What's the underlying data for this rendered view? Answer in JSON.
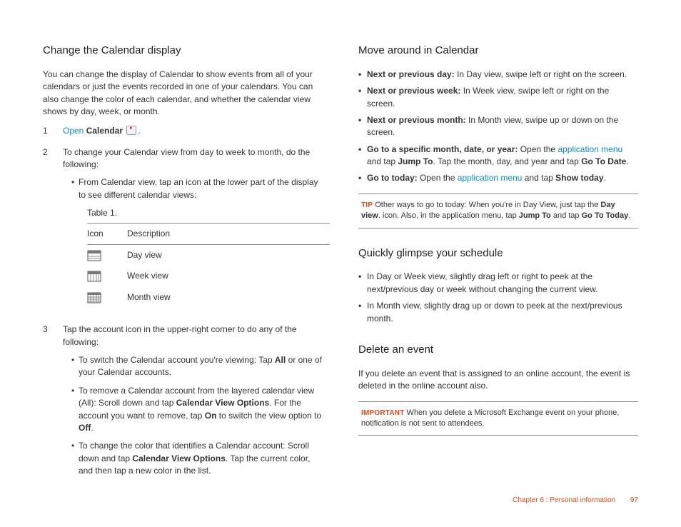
{
  "left": {
    "h1": "Change the Calendar display",
    "intro": "You can change the display of Calendar to show events from all of your calendars or just the events recorded in one of your calendars. You can also change the color of each calendar, and whether the calendar view shows by day, week, or month.",
    "step1_open": "Open",
    "step1_calendar": "Calendar",
    "step2": "To change your Calendar view from day to week to month, do the following:",
    "step2_bullet": "From Calendar view, tap an icon at the lower part of the display to see different calendar views:",
    "table_caption": "Table 1.",
    "th_icon": "Icon",
    "th_desc": "Description",
    "row_day": "Day view",
    "row_week": "Week view",
    "row_month": "Month view",
    "step3": "Tap the account icon in the upper-right corner to do any of the following:",
    "s3b1_a": "To switch the Calendar account you're viewing: Tap ",
    "s3b1_all": "All",
    "s3b1_b": " or one of your Calendar accounts.",
    "s3b2_a": "To remove a Calendar account from the layered calendar view (All): Scroll down and tap ",
    "s3b2_cvo": "Calendar View Options",
    "s3b2_b": ". For the account you want to remove, tap ",
    "s3b2_on": "On",
    "s3b2_c": " to switch the view option to ",
    "s3b2_off": "Off",
    "s3b2_d": ".",
    "s3b3_a": "To change the color that identifies a Calendar account: Scroll down and tap ",
    "s3b3_cvo": "Calendar View Options",
    "s3b3_b": ". Tap the current color, and then tap a new color in the list."
  },
  "right": {
    "h_move": "Move around in Calendar",
    "m1_b": "Next or previous day:",
    "m1_t": " In Day view, swipe left or right on the screen.",
    "m2_b": "Next or previous week:",
    "m2_t": " In Week view, swipe left or right on the screen.",
    "m3_b": "Next or previous month:",
    "m3_t": " In Month view, swipe up or down on the screen.",
    "m4_b": "Go to a specific month, date, or year:",
    "m4_t1": " Open the ",
    "m4_link": "application menu",
    "m4_t2": " and tap ",
    "m4_jump": "Jump To",
    "m4_t3": ". Tap the month, day, and year and tap ",
    "m4_gtd": "Go To Date",
    "m4_t4": ".",
    "m5_b": "Go to today:",
    "m5_t1": " Open the ",
    "m5_link": "application menu",
    "m5_t2": " and tap ",
    "m5_show": "Show today",
    "m5_t3": ".",
    "tip_label": "TIP",
    "tip_a": "  Other ways to go to today: When you're in Day View, just tap the ",
    "tip_dv": "Day view",
    "tip_b": ". icon. Also, in the application menu, tap ",
    "tip_jt": "Jump To",
    "tip_c": " and tap ",
    "tip_gtt": "Go To Today",
    "tip_d": ".",
    "h_glimpse": "Quickly glimpse your schedule",
    "g1": "In Day or Week view, slightly drag left or right to peek at the next/previous day or week without changing the current view.",
    "g2": "In Month view, slightly drag up or down to peek at the next/previous month.",
    "h_delete": "Delete an event",
    "del_p": "If you delete an event that is assigned to an online account, the event is deleted in the online account also.",
    "imp_label": "IMPORTANT",
    "imp_t": "   When you delete a Microsoft Exchange event on your phone, notification is not sent to attendees."
  },
  "footer": {
    "chapter": "Chapter 6  :  Personal information",
    "page": "97"
  }
}
